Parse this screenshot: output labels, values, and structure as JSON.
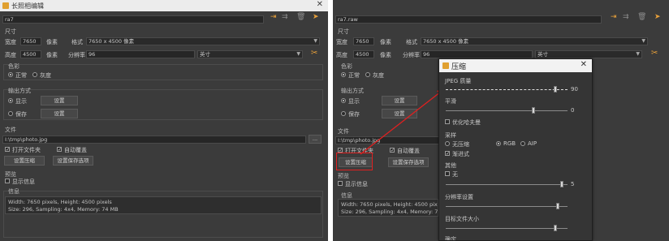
{
  "left": {
    "title": "长照相编辑",
    "name_value": "ra7",
    "size_label": "尺寸",
    "width_label": "宽度",
    "width_value": "7650",
    "height_label": "高度",
    "height_value": "4500",
    "unit_label": "像素",
    "format_label": "格式",
    "format_value": "7650 x 4500 像素",
    "resolution_label": "分辨率",
    "resolution_value": "96",
    "resolution_unit": "英寸",
    "color_label": "色彩",
    "mode_normal": "正常",
    "mode_gray": "灰度",
    "output_label": "输出方式",
    "output_opt1": "显示",
    "output_btn1": "设置",
    "output_opt2": "保存",
    "output_btn2": "设置",
    "file_label": "文件",
    "file_value": "I:\\tmp\\photo.jpg",
    "browse": "...",
    "chk_open": "打开文件夹",
    "chk_overwrite": "自动覆盖",
    "btn_compress": "设置压缩",
    "btn_saveas": "设置保存选项",
    "preview_label": "预览",
    "show_info": "显示信息",
    "info_label": "信息",
    "info_line1": "Width: 7650 pixels, Height: 4500 pixels",
    "info_line2": "Size: 296, Sampling: 4x4, Memory: 74 MB"
  },
  "right": {
    "title_value": "ra7.raw",
    "size_label": "尺寸",
    "width_label": "宽度",
    "width_value": "7650",
    "height_label": "高度",
    "height_value": "4500",
    "unit_label": "像素",
    "format_label": "格式",
    "format_value": "7650 x 4500 像素",
    "resolution_label": "分辨率",
    "resolution_value": "96",
    "resolution_unit": "英寸",
    "color_label": "色彩",
    "mode_normal": "正常",
    "mode_gray": "灰度",
    "output_label": "输出方式",
    "output_opt1": "显示",
    "output_btn1": "设置",
    "output_opt2": "保存",
    "output_btn2": "设置",
    "file_label": "文件",
    "file_value": "I:\\tmp\\photo.jpg",
    "chk_open": "打开文件夹",
    "chk_overwrite": "自动覆盖",
    "btn_compress": "设置压缩",
    "btn_saveas": "设置保存选项",
    "preview_label": "预览",
    "show_info": "显示信息",
    "info_label": "信息",
    "info_line1": "Width: 7650 pixels, Height: 4500 pixels",
    "info_line2": "Size: 296, Sampling: 4x4, Memory: 74 MB"
  },
  "dialog": {
    "title": "压缩",
    "quality_label": "JPEG 质量",
    "quality_value": "90",
    "quality_level": 0.9,
    "smooth_label": "平滑",
    "smooth_value": "0",
    "smooth_level": 0.72,
    "optimize": "优化哈夫曼",
    "sampling_label": "采样",
    "sampling_none": "无压缩",
    "sampling_rgb": "RGB",
    "sampling_aip": "AIP",
    "progressive": "渐进式",
    "pt_label": "其他",
    "pt_none": "无",
    "pt_value": "5",
    "pt_level": 0.95,
    "dpi_label": "分辨率设置",
    "dpi_level": 0.92,
    "quality_target_label": "目标文件大小",
    "quality_target_level": 0.9,
    "bottom_text": "确定"
  },
  "colors": {
    "panel": "#3b3b3b",
    "accent_orange": "#e8a03a",
    "annotation_red": "#e02020"
  }
}
